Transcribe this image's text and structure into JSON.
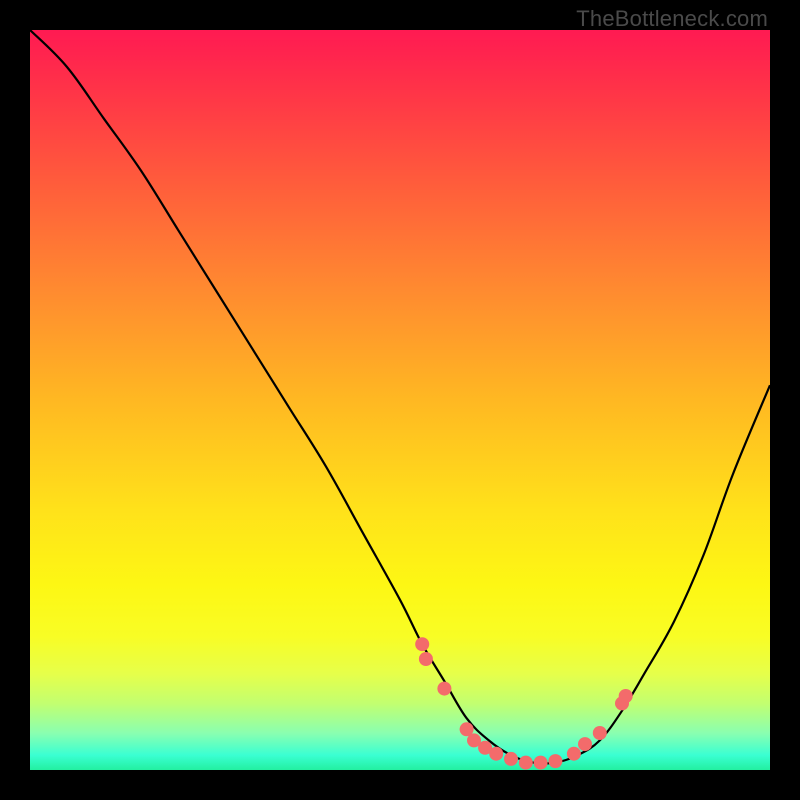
{
  "watermark": "TheBottleneck.com",
  "colors": {
    "background": "#000000",
    "curve": "#000000",
    "dot_fill": "#f36b6b",
    "dot_stroke": "#c94a4a"
  },
  "chart_data": {
    "type": "line",
    "title": "",
    "xlabel": "",
    "ylabel": "",
    "xlim": [
      0,
      100
    ],
    "ylim": [
      0,
      100
    ],
    "series": [
      {
        "name": "bottleneck-curve",
        "x": [
          0,
          5,
          10,
          15,
          20,
          25,
          30,
          35,
          40,
          45,
          50,
          53,
          56,
          59,
          62,
          65,
          68,
          71,
          74,
          77,
          80,
          83,
          87,
          91,
          95,
          100
        ],
        "y": [
          100,
          95,
          88,
          81,
          73,
          65,
          57,
          49,
          41,
          32,
          23,
          17,
          12,
          7,
          4,
          2,
          1,
          1,
          2,
          4,
          8,
          13,
          20,
          29,
          40,
          52
        ]
      }
    ],
    "highlight_points": {
      "x": [
        53,
        53.5,
        56,
        59,
        60,
        61.5,
        63,
        65,
        67,
        69,
        71,
        73.5,
        75,
        77,
        80,
        80.5
      ],
      "y": [
        17,
        15,
        11,
        5.5,
        4,
        3,
        2.2,
        1.5,
        1,
        1,
        1.2,
        2.2,
        3.5,
        5,
        9,
        10
      ]
    }
  }
}
